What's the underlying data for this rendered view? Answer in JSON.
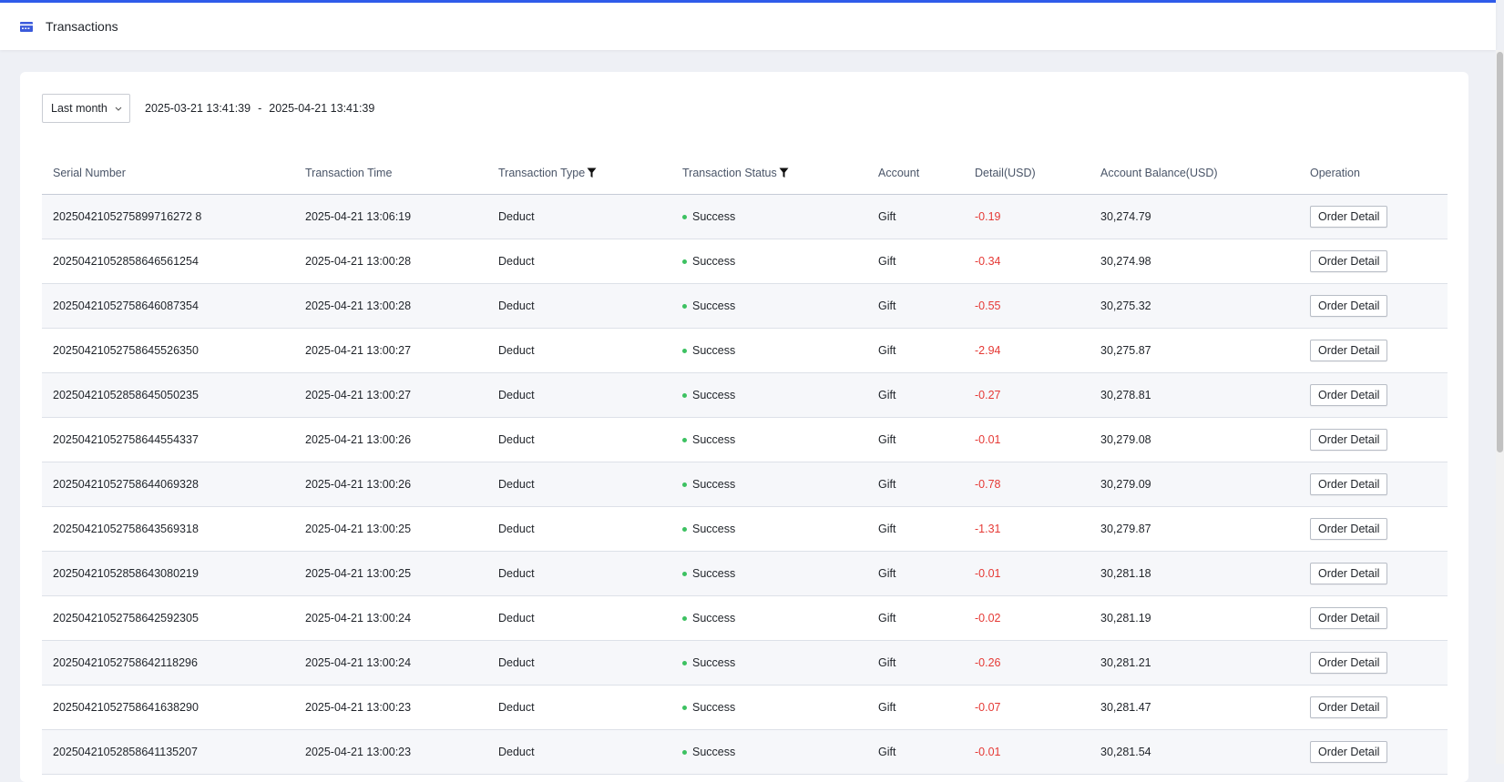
{
  "header": {
    "title": "Transactions",
    "icon": "wallet-icon",
    "accent_color": "#2f5bea"
  },
  "filters": {
    "range_label": "Last month",
    "date_start": "2025-03-21 13:41:39",
    "date_separator": "-",
    "date_end": "2025-04-21 13:41:39"
  },
  "table": {
    "columns": {
      "serial": "Serial Number",
      "time": "Transaction Time",
      "type": "Transaction Type",
      "status": "Transaction Status",
      "account": "Account",
      "detail": "Detail(USD)",
      "balance": "Account Balance(USD)",
      "operation": "Operation"
    },
    "rows": [
      {
        "serial": "2025042105275899716272 8",
        "time": "2025-04-21 13:06:19",
        "type": "Deduct",
        "status": "Success",
        "account": "Gift",
        "detail": "-0.19",
        "balance": "30,274.79",
        "action": "Order Detail"
      },
      {
        "serial": "20250421052858646561254",
        "time": "2025-04-21 13:00:28",
        "type": "Deduct",
        "status": "Success",
        "account": "Gift",
        "detail": "-0.34",
        "balance": "30,274.98",
        "action": "Order Detail"
      },
      {
        "serial": "20250421052758646087354",
        "time": "2025-04-21 13:00:28",
        "type": "Deduct",
        "status": "Success",
        "account": "Gift",
        "detail": "-0.55",
        "balance": "30,275.32",
        "action": "Order Detail"
      },
      {
        "serial": "20250421052758645526350",
        "time": "2025-04-21 13:00:27",
        "type": "Deduct",
        "status": "Success",
        "account": "Gift",
        "detail": "-2.94",
        "balance": "30,275.87",
        "action": "Order Detail"
      },
      {
        "serial": "20250421052858645050235",
        "time": "2025-04-21 13:00:27",
        "type": "Deduct",
        "status": "Success",
        "account": "Gift",
        "detail": "-0.27",
        "balance": "30,278.81",
        "action": "Order Detail"
      },
      {
        "serial": "20250421052758644554337",
        "time": "2025-04-21 13:00:26",
        "type": "Deduct",
        "status": "Success",
        "account": "Gift",
        "detail": "-0.01",
        "balance": "30,279.08",
        "action": "Order Detail"
      },
      {
        "serial": "20250421052758644069328",
        "time": "2025-04-21 13:00:26",
        "type": "Deduct",
        "status": "Success",
        "account": "Gift",
        "detail": "-0.78",
        "balance": "30,279.09",
        "action": "Order Detail"
      },
      {
        "serial": "20250421052758643569318",
        "time": "2025-04-21 13:00:25",
        "type": "Deduct",
        "status": "Success",
        "account": "Gift",
        "detail": "-1.31",
        "balance": "30,279.87",
        "action": "Order Detail"
      },
      {
        "serial": "20250421052858643080219",
        "time": "2025-04-21 13:00:25",
        "type": "Deduct",
        "status": "Success",
        "account": "Gift",
        "detail": "-0.01",
        "balance": "30,281.18",
        "action": "Order Detail"
      },
      {
        "serial": "20250421052758642592305",
        "time": "2025-04-21 13:00:24",
        "type": "Deduct",
        "status": "Success",
        "account": "Gift",
        "detail": "-0.02",
        "balance": "30,281.19",
        "action": "Order Detail"
      },
      {
        "serial": "20250421052758642118296",
        "time": "2025-04-21 13:00:24",
        "type": "Deduct",
        "status": "Success",
        "account": "Gift",
        "detail": "-0.26",
        "balance": "30,281.21",
        "action": "Order Detail"
      },
      {
        "serial": "20250421052758641638290",
        "time": "2025-04-21 13:00:23",
        "type": "Deduct",
        "status": "Success",
        "account": "Gift",
        "detail": "-0.07",
        "balance": "30,281.47",
        "action": "Order Detail"
      },
      {
        "serial": "20250421052858641135207",
        "time": "2025-04-21 13:00:23",
        "type": "Deduct",
        "status": "Success",
        "account": "Gift",
        "detail": "-0.01",
        "balance": "30,281.54",
        "action": "Order Detail"
      }
    ]
  },
  "colors": {
    "negative": "#e53935",
    "success_dot": "#3cc161"
  }
}
